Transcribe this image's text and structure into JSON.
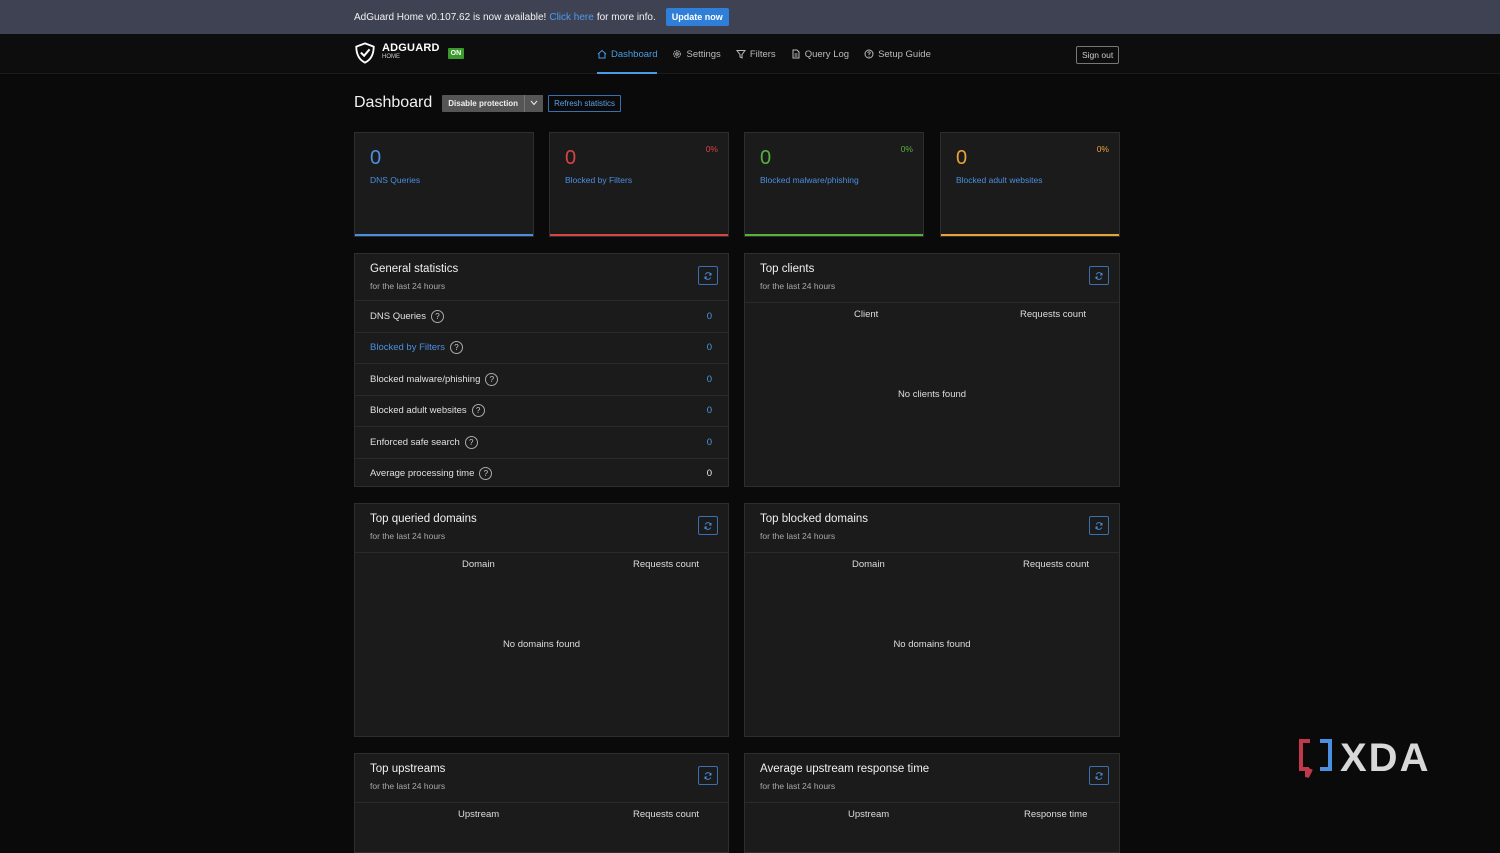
{
  "banner": {
    "text": "AdGuard Home v0.107.62 is now available!",
    "link": "Click here",
    "after": "for more info.",
    "update_button": "Update now"
  },
  "brand": {
    "name": "ADGUARD",
    "sub": "HOME",
    "status": "ON"
  },
  "nav": [
    {
      "label": "Dashboard",
      "icon": "home-icon",
      "active": true
    },
    {
      "label": "Settings",
      "icon": "gear-icon",
      "active": false
    },
    {
      "label": "Filters",
      "icon": "filter-icon",
      "active": false
    },
    {
      "label": "Query Log",
      "icon": "document-icon",
      "active": false
    },
    {
      "label": "Setup Guide",
      "icon": "help-icon",
      "active": false
    }
  ],
  "signout": "Sign out",
  "page": {
    "title": "Dashboard",
    "disable_protection": "Disable protection",
    "refresh_statistics": "Refresh statistics"
  },
  "stats": [
    {
      "value": "0",
      "label": "DNS Queries",
      "percent": "",
      "color": "#4a8fe0"
    },
    {
      "value": "0",
      "label": "Blocked by Filters",
      "percent": "0%",
      "color": "#d84343"
    },
    {
      "value": "0",
      "label": "Blocked malware/phishing",
      "percent": "0%",
      "color": "#55b23a"
    },
    {
      "value": "0",
      "label": "Blocked adult websites",
      "percent": "0%",
      "color": "#e8a23a"
    }
  ],
  "general": {
    "title": "General statistics",
    "subtitle": "for the last 24 hours",
    "rows": [
      {
        "label": "DNS Queries",
        "value": "0"
      },
      {
        "label": "Blocked by Filters",
        "value": "0"
      },
      {
        "label": "Blocked malware/phishing",
        "value": "0"
      },
      {
        "label": "Blocked adult websites",
        "value": "0"
      },
      {
        "label": "Enforced safe search",
        "value": "0"
      },
      {
        "label": "Average processing time",
        "value": "0"
      }
    ]
  },
  "top_clients": {
    "title": "Top clients",
    "subtitle": "for the last 24 hours",
    "col1": "Client",
    "col2": "Requests count",
    "empty": "No clients found"
  },
  "top_queried": {
    "title": "Top queried domains",
    "subtitle": "for the last 24 hours",
    "col1": "Domain",
    "col2": "Requests count",
    "empty": "No domains found"
  },
  "top_blocked": {
    "title": "Top blocked domains",
    "subtitle": "for the last 24 hours",
    "col1": "Domain",
    "col2": "Requests count",
    "empty": "No domains found"
  },
  "top_upstreams": {
    "title": "Top upstreams",
    "subtitle": "for the last 24 hours",
    "col1": "Upstream",
    "col2": "Requests count"
  },
  "avg_upstream": {
    "title": "Average upstream response time",
    "subtitle": "for the last 24 hours",
    "col1": "Upstream",
    "col2": "Response time"
  },
  "watermark": "XDA"
}
